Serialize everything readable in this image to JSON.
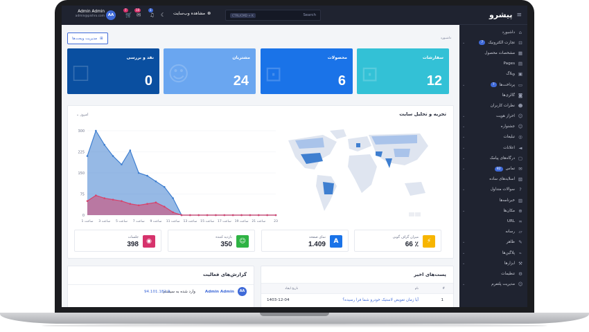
{
  "topbar": {
    "user_name": "Admin Admin",
    "user_email": "admin@pishro.com",
    "avatar_initials": "AA",
    "badges": [
      "7",
      "10",
      "1"
    ],
    "visit_site_label": "مشاهده وب‌سایت",
    "search_shortcut": "CTRL/CMD + K",
    "search_placeholder": "Search"
  },
  "logo": "پیشرو",
  "sidebar": {
    "items": [
      {
        "label": "داشبورد",
        "icon": "home-icon"
      },
      {
        "label": "تجارت الکترونیک",
        "badge": "7",
        "icon": "cart-icon"
      },
      {
        "label": "مشخصات محصول",
        "icon": "grid-icon"
      },
      {
        "label": "Pages",
        "icon": "page-icon"
      },
      {
        "label": "وبلاگ",
        "icon": "blog-icon"
      },
      {
        "label": "پرداخت‌ها",
        "badge": "7",
        "icon": "card-icon"
      },
      {
        "label": "گالری‌ها",
        "icon": "camera-icon"
      },
      {
        "label": "نظرات کاربران",
        "icon": "users-icon"
      },
      {
        "label": "احراز هویت",
        "icon": "user-icon"
      },
      {
        "label": "جشنواره",
        "icon": "user-icon"
      },
      {
        "label": "تبلیغات",
        "icon": "ad-icon"
      },
      {
        "label": "اعلانات",
        "icon": "megaphone-icon"
      },
      {
        "label": "درگاه‌های پیامک",
        "icon": "sms-icon"
      },
      {
        "label": "تماس",
        "badge": "82",
        "icon": "mail-icon"
      },
      {
        "label": "اسلایدهای ساده",
        "icon": "slider-icon"
      },
      {
        "label": "سوالات متداول",
        "icon": "help-icon"
      },
      {
        "label": "خبرنامه‌ها",
        "icon": "inbox-icon"
      },
      {
        "label": "مکان‌ها",
        "icon": "globe-icon"
      },
      {
        "label": "URL",
        "icon": "link-icon"
      },
      {
        "label": "رسانه",
        "icon": "folder-icon"
      },
      {
        "label": "ظاهر",
        "icon": "brush-icon"
      },
      {
        "label": "پلاگین‌ها",
        "icon": "plug-icon"
      },
      {
        "label": "ابزارها",
        "icon": "tool-icon"
      },
      {
        "label": "تنظیمات",
        "icon": "gear-icon"
      },
      {
        "label": "مدیریت پلتفرم",
        "icon": "user-cog-icon"
      }
    ]
  },
  "breadcrumb": "داشبورد",
  "manage_widgets_label": "مدیریت ویجت‌ها",
  "stat_cards": [
    {
      "title": "سفارشات",
      "value": "12",
      "color": "#33c1d6"
    },
    {
      "title": "محصولات",
      "value": "6",
      "color": "#1a73e8"
    },
    {
      "title": "مشتریان",
      "value": "24",
      "color": "#6aa6f0"
    },
    {
      "title": "نقد و بررسی",
      "value": "0",
      "color": "#0a4fa0"
    }
  ],
  "analytics": {
    "title": "تجزیه و تحلیل سایت",
    "range_label": "امروز"
  },
  "chart_data": {
    "type": "area",
    "title": "تجزیه و تحلیل سایت",
    "x": [
      "1 ساعت",
      "2 ساعت",
      "3 ساعت",
      "4 ساعت",
      "5 ساعت",
      "6 ساعت",
      "7 ساعت",
      "8 ساعت",
      "9 ساعت",
      "10 ساعت",
      "11 ساعت",
      "12 ساعت",
      "13 ساعت",
      "14 ساعت",
      "15 ساعت",
      "16 ساعت",
      "17 ساعت",
      "18 ساعت",
      "19 ساعت",
      "20 ساعت",
      "21 ساعت",
      "22 ساعت",
      "23 ساعت"
    ],
    "x_tick_labels": [
      "1 ساعت",
      "3 ساعت",
      "5 ساعت",
      "7 ساعت",
      "9 ساعت",
      "11 ساعت",
      "13 ساعت",
      "15 ساعت",
      "17 ساعت",
      "19 ساعت",
      "21 ساعت",
      "23"
    ],
    "y_ticks": [
      0,
      75,
      150,
      225,
      300
    ],
    "ylim": [
      0,
      300
    ],
    "series": [
      {
        "values": [
          210,
          300,
          250,
          210,
          180,
          230,
          150,
          140,
          120,
          100,
          60,
          0,
          0,
          0,
          0,
          0,
          0,
          0,
          0,
          0,
          0,
          0,
          0
        ],
        "color": "#3f7fd0"
      },
      {
        "values": [
          50,
          70,
          60,
          55,
          50,
          40,
          35,
          40,
          45,
          30,
          10,
          0,
          0,
          0,
          0,
          0,
          0,
          0,
          0,
          0,
          0,
          0,
          0
        ],
        "color": "#d7436b"
      }
    ]
  },
  "mini_stats": [
    {
      "label": "میزان گزاف گویی",
      "value": "66 ٪",
      "color": "#f7b500",
      "icon": "bolt-icon"
    },
    {
      "label": "نمای صفحه",
      "value": "1.409",
      "color": "#1a73e8",
      "icon": "a-icon"
    },
    {
      "label": "بازدید کننده",
      "value": "350",
      "color": "#2fb344",
      "icon": "visitors-icon"
    },
    {
      "label": "جلسات",
      "value": "398",
      "color": "#d6336c",
      "icon": "eye-icon"
    }
  ],
  "recent_posts": {
    "title": "پست‌های اخیر",
    "columns": [
      "#",
      "نام",
      "تاریخ ایجاد"
    ],
    "rows": [
      {
        "id": "1",
        "name": "آیا زمان تعویض لاستیک خودرو شما فرا رسیده؟",
        "date": "1403-12-04"
      }
    ]
  },
  "activity": {
    "title": "گزارش‌های فعالیت",
    "items": [
      {
        "initials": "AA",
        "user": "Admin Admin",
        "text": "وارد شده به سیستم",
        "ip": "94.101.182.9"
      }
    ]
  },
  "colors": {
    "sidebar_bg": "#1f2330",
    "accent": "#3f6ad8",
    "map_highlight": "#3f7fd0"
  }
}
